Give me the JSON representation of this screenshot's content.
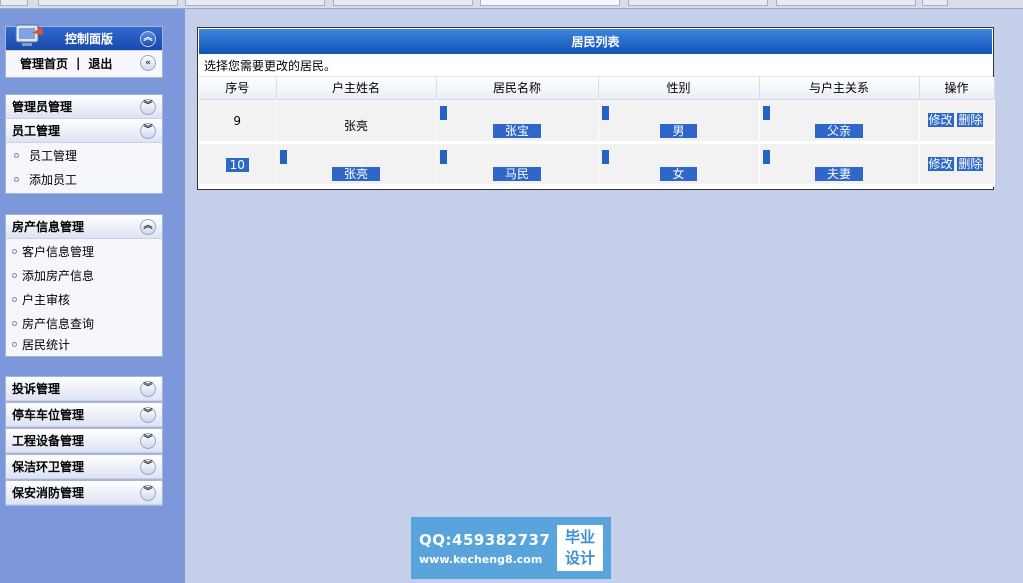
{
  "sidebar": {
    "control_panel": {
      "title": "控制面版",
      "nav_home": "管理首页",
      "nav_sep": "|",
      "nav_logout": "退出"
    },
    "admin_group": {
      "title": "管理员管理"
    },
    "staff_group": {
      "title": "员工管理",
      "items": [
        "员工管理",
        "添加员工"
      ]
    },
    "property_group": {
      "title": "房产信息管理",
      "items": [
        "客户信息管理",
        "添加房产信息",
        "户主审核",
        "房产信息查询",
        "居民统计"
      ]
    },
    "other_groups": [
      "投诉管理",
      "停车车位管理",
      "工程设备管理",
      "保洁环卫管理",
      "保安消防管理"
    ]
  },
  "main": {
    "title": "居民列表",
    "hint": "选择您需要更改的居民。",
    "columns": [
      "序号",
      "户主姓名",
      "居民名称",
      "性别",
      "与户主关系",
      "操作"
    ],
    "rows": [
      {
        "seq": "9",
        "owner": "张亮",
        "resident": "张宝",
        "gender": "男",
        "relation": "父亲",
        "edit": "修改",
        "delete": "删除"
      },
      {
        "seq": "10",
        "owner": "张亮",
        "resident": "马民",
        "gender": "女",
        "relation": "夫妻",
        "edit": "修改",
        "delete": "删除"
      }
    ]
  },
  "watermark": {
    "qq": "QQ:459382737",
    "url": "www.kecheng8.com",
    "badge_line1": "毕业",
    "badge_line2": "设计"
  },
  "colors": {
    "sidebar_bg": "#7c98db",
    "main_bg": "#c5cfe9",
    "header_blue": "#1a5ec0",
    "selection": "#2e67c8"
  }
}
